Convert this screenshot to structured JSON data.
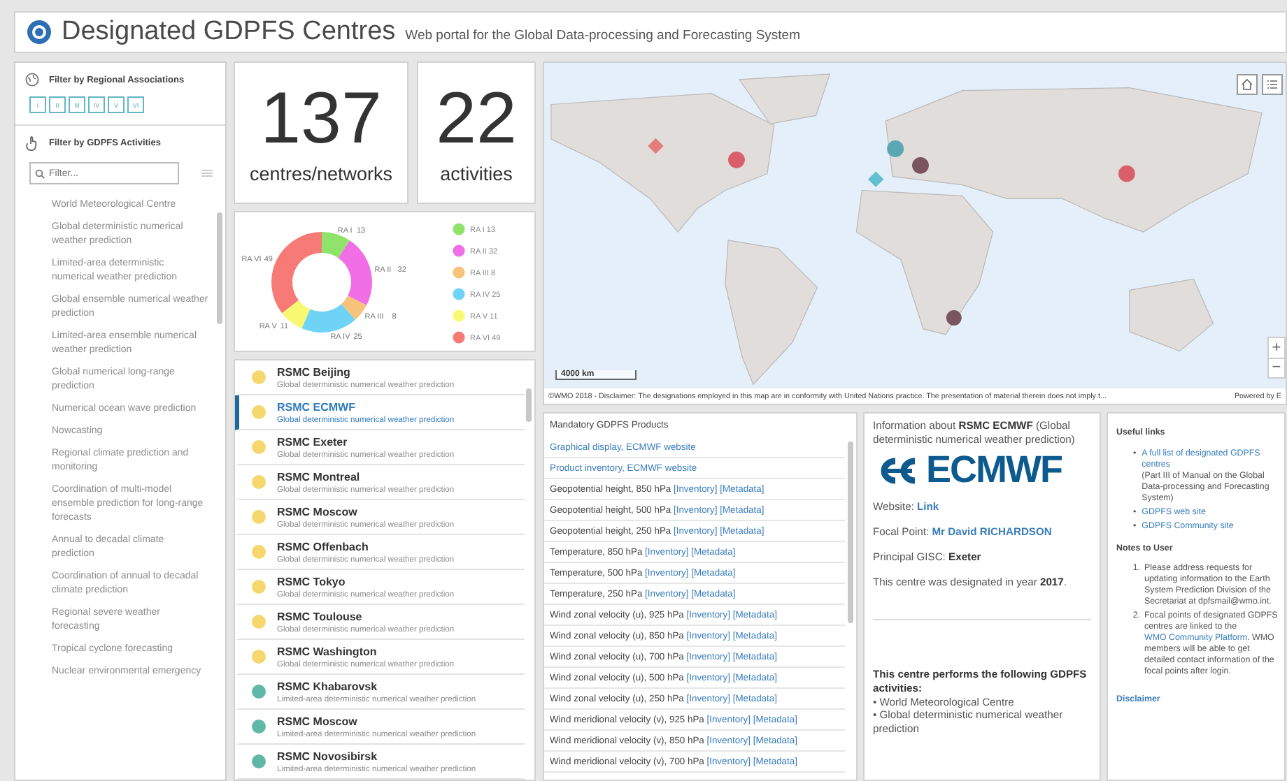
{
  "header": {
    "title": "Designated GDPFS Centres",
    "subtitle": "Web portal for the Global Data-processing and Forecasting System"
  },
  "sidebar": {
    "ra_filter": {
      "label": "Filter by Regional Associations",
      "buttons": [
        "I",
        "II",
        "III",
        "IV",
        "V",
        "VI"
      ]
    },
    "activity_filter": {
      "label": "Filter by GDPFS Activities",
      "placeholder": "Filter..."
    },
    "activities": [
      "World Meteorological Centre",
      "Global deterministic numerical weather prediction",
      "Limited-area deterministic numerical weather prediction",
      "Global ensemble numerical weather prediction",
      "Limited-area ensemble numerical weather prediction",
      "Global numerical long-range prediction",
      "Numerical ocean wave prediction",
      "Nowcasting",
      "Regional climate prediction and monitoring",
      "Coordination of multi-model ensemble prediction for long-range forecasts",
      "Annual to decadal climate prediction",
      "Coordination of annual to decadal climate prediction",
      "Regional severe weather forecasting",
      "Tropical cyclone forecasting",
      "Nuclear environmental emergency"
    ]
  },
  "stats": [
    {
      "value": "137",
      "label": "centres/networks"
    },
    {
      "value": "22",
      "label": "activities"
    }
  ],
  "distribution": {
    "chart_data": {
      "type": "donut",
      "categories": [
        "RA I",
        "RA II",
        "RA III",
        "RA IV",
        "RA V",
        "RA VI"
      ],
      "series": [
        {
          "values": [
            13,
            32,
            8,
            25,
            11,
            49
          ]
        }
      ],
      "data_labels": true
    },
    "legend": [
      {
        "label": "RA I 13",
        "color": "#8fe36b"
      },
      {
        "label": "RA II 32",
        "color": "#f06ee6"
      },
      {
        "label": "RA III 8",
        "color": "#f7c27a"
      },
      {
        "label": "RA IV 25",
        "color": "#6fd3f5"
      },
      {
        "label": "RA V 11",
        "color": "#f9f871"
      },
      {
        "label": "RA VI 49",
        "color": "#f77a76"
      }
    ]
  },
  "centres": [
    {
      "name": "RSMC Beijing",
      "activity": "Global deterministic numerical weather prediction",
      "color": "#f5d76e",
      "selected": false
    },
    {
      "name": "RSMC ECMWF",
      "activity": "Global deterministic numerical weather prediction",
      "color": "#f5d76e",
      "selected": true
    },
    {
      "name": "RSMC Exeter",
      "activity": "Global deterministic numerical weather prediction",
      "color": "#f5d76e",
      "selected": false
    },
    {
      "name": "RSMC Montreal",
      "activity": "Global deterministic numerical weather prediction",
      "color": "#f5d76e",
      "selected": false
    },
    {
      "name": "RSMC Moscow",
      "activity": "Global deterministic numerical weather prediction",
      "color": "#f5d76e",
      "selected": false
    },
    {
      "name": "RSMC Offenbach",
      "activity": "Global deterministic numerical weather prediction",
      "color": "#f5d76e",
      "selected": false
    },
    {
      "name": "RSMC Tokyo",
      "activity": "Global deterministic numerical weather prediction",
      "color": "#f5d76e",
      "selected": false
    },
    {
      "name": "RSMC Toulouse",
      "activity": "Global deterministic numerical weather prediction",
      "color": "#f5d76e",
      "selected": false
    },
    {
      "name": "RSMC Washington",
      "activity": "Global deterministic numerical weather prediction",
      "color": "#f5d76e",
      "selected": false
    },
    {
      "name": "RSMC Khabarovsk",
      "activity": "Limited-area deterministic numerical weather prediction",
      "color": "#5fb8a5",
      "selected": false
    },
    {
      "name": "RSMC Moscow",
      "activity": "Limited-area deterministic numerical weather prediction",
      "color": "#5fb8a5",
      "selected": false
    },
    {
      "name": "RSMC Novosibirsk",
      "activity": "Limited-area deterministic numerical weather prediction",
      "color": "#5fb8a5",
      "selected": false
    }
  ],
  "map": {
    "scale_label": "4000 km",
    "attribution": "©WMO 2018 - Disclaimer: The designations employed in this map are in conformity with United Nations practice. The presentation of material therein does not imply t...",
    "powered_by": "Powered by E",
    "zoom_in": "+",
    "zoom_out": "−"
  },
  "products": {
    "title": "Mandatory GDPFS Products",
    "rows": [
      {
        "kind": "link",
        "text": "Graphical display, ECMWF website"
      },
      {
        "kind": "link",
        "text": "Product inventory, ECMWF website"
      },
      {
        "kind": "product",
        "text": "Geopotential height, 850 hPa",
        "links": [
          "[Inventory]",
          "[Metadata]"
        ]
      },
      {
        "kind": "product",
        "text": "Geopotential height, 500 hPa",
        "links": [
          "[Inventory]",
          "[Metadata]"
        ]
      },
      {
        "kind": "product",
        "text": "Geopotential height, 250 hPa",
        "links": [
          "[Inventory]",
          "[Metadata]"
        ]
      },
      {
        "kind": "product",
        "text": "Temperature, 850 hPa",
        "links": [
          "[Inventory]",
          "[Metadata]"
        ]
      },
      {
        "kind": "product",
        "text": "Temperature, 500 hPa",
        "links": [
          "[Inventory]",
          "[Metadata]"
        ]
      },
      {
        "kind": "product",
        "text": "Temperature, 250 hPa",
        "links": [
          "[Inventory]",
          "[Metadata]"
        ]
      },
      {
        "kind": "product",
        "text": "Wind zonal velocity (u), 925 hPa",
        "links": [
          "[Inventory]",
          "[Metadata]"
        ]
      },
      {
        "kind": "product",
        "text": "Wind zonal velocity (u), 850 hPa",
        "links": [
          "[Inventory]",
          "[Metadata]"
        ]
      },
      {
        "kind": "product",
        "text": "Wind zonal velocity (u), 700 hPa",
        "links": [
          "[Inventory]",
          "[Metadata]"
        ]
      },
      {
        "kind": "product",
        "text": "Wind zonal velocity (u), 500 hPa",
        "links": [
          "[Inventory]",
          "[Metadata]"
        ]
      },
      {
        "kind": "product",
        "text": "Wind zonal velocity (u), 250 hPa",
        "links": [
          "[Inventory]",
          "[Metadata]"
        ]
      },
      {
        "kind": "product",
        "text": "Wind meridional velocity (v), 925 hPa",
        "links": [
          "[Inventory]",
          "[Metadata]"
        ]
      },
      {
        "kind": "product",
        "text": "Wind meridional velocity (v), 850 hPa",
        "links": [
          "[Inventory]",
          "[Metadata]"
        ]
      },
      {
        "kind": "product",
        "text": "Wind meridional velocity (v), 700 hPa",
        "links": [
          "[Inventory]",
          "[Metadata]"
        ]
      }
    ]
  },
  "info": {
    "heading": "Information about **RSMC ECMWF** (Global deterministic numerical weather prediction)",
    "logo_text": "ECMWF",
    "website_label": "Website:",
    "website_link": "Link",
    "focal_label": "Focal Point:",
    "focal_link": "Mr David RICHARDSON",
    "gisc": "Principal GISC: **Exeter**",
    "designated": "This centre was designated in year **2017**.",
    "activities_title": "This centre performs the following GDPFS activities:",
    "activities": [
      "• World Meteorological Centre",
      "• Global deterministic numerical weather prediction"
    ]
  },
  "useful": {
    "links_title": "Useful links",
    "links": [
      {
        "bullet": "•",
        "link": "A full list of designated GDPFS centres",
        "note": "(Part III of Manual on the Global Data-processing and Forecasting System)"
      },
      {
        "bullet": "•",
        "link": "GDPFS web site"
      },
      {
        "bullet": "•",
        "link": "GDPFS Community site"
      }
    ],
    "notes_title": "Notes to User",
    "notes": [
      {
        "number": "1.",
        "before": "Please address requests for updating information to the Earth System Prediction Division of the Secretariat at dpfsmail@wmo.int."
      },
      {
        "number": "2.",
        "before": "Focal points of designated GDPFS centres are linked to the",
        "link": "WMO Community Platform",
        "after": ". WMO members will be able to get detailed contact information of the focal points after login."
      }
    ],
    "disclaimer": "Disclaimer"
  }
}
